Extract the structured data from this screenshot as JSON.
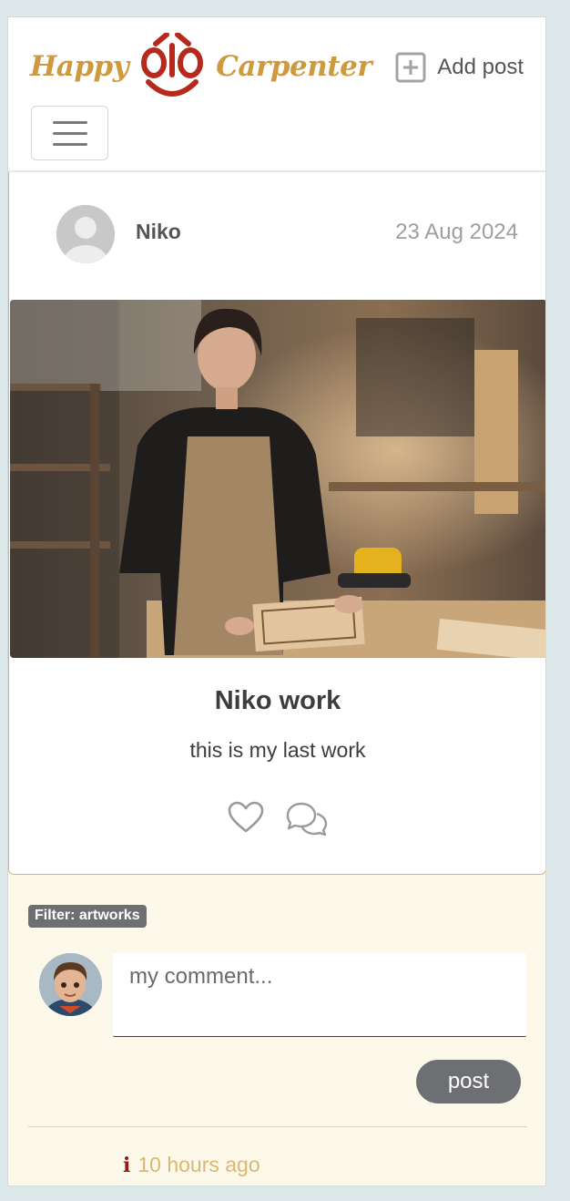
{
  "brand": {
    "left_word": "Happy",
    "right_word": "Carpenter",
    "logo_icon": "smiling-face-logo",
    "colors": {
      "gold": "#cf9a3f",
      "red": "#b52a1c"
    }
  },
  "nav": {
    "add_post_label": "Add post",
    "add_post_icon": "plus-square-icon",
    "menu_icon": "hamburger-icon"
  },
  "post": {
    "author": "Niko",
    "date": "23 Aug 2024",
    "title": "Niko work",
    "body": "this is my last work",
    "image_alt": "Woman in apron standing at a woodworking bench with carved wood panels",
    "like_icon": "heart-icon",
    "comment_icon": "comments-icon",
    "border_color": "#d9b46a"
  },
  "comments": {
    "filter_badge": "Filter: artworks",
    "placeholder": "my comment...",
    "post_button": "post",
    "last_comment_time": "10 hours ago",
    "info_glyph": "i",
    "colors": {
      "background": "#fdf9ea",
      "accent": "#8b1d1d",
      "time": "#d8b873"
    }
  }
}
